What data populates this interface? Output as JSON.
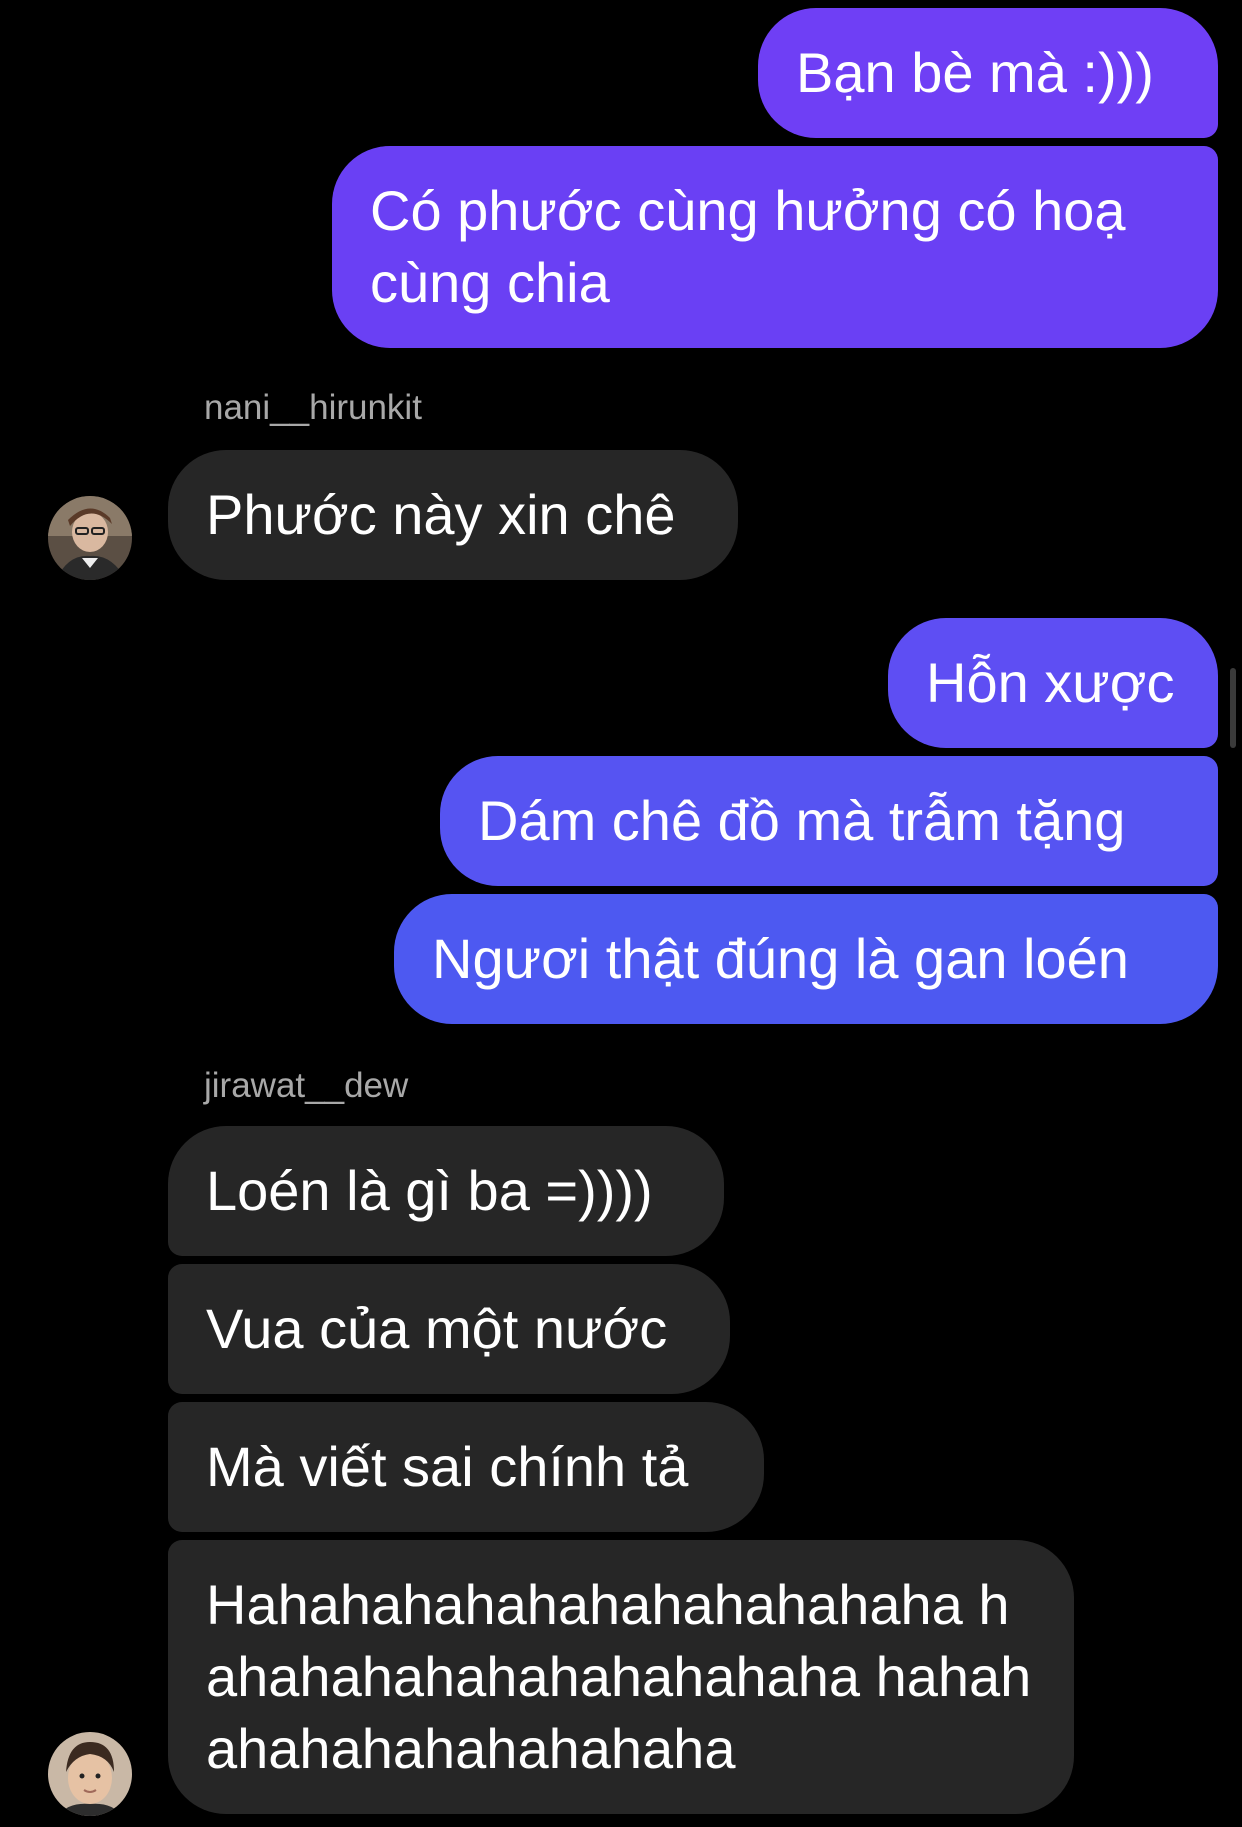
{
  "colors": {
    "background": "#000000",
    "outgoing_bubble_top": "#6f3ff5",
    "outgoing_bubble_mid": "#5a4ff2",
    "outgoing_bubble_bottom": "#4a5bf0",
    "incoming_bubble": "#262626",
    "text": "#ffffff",
    "sender_name": "#a8a8a8"
  },
  "messages": {
    "out_1": "Bạn bè mà :)))",
    "out_2": "Có phước cùng hưởng có hoạ cùng chia",
    "in_group_1": {
      "sender": "nani__hirunkit",
      "avatar_icon": "user-avatar-nani",
      "msg_1": "Phước này xin chê"
    },
    "out_3": "Hỗn xược",
    "out_4": "Dám chê đồ mà trẫm tặng",
    "out_5": "Ngươi thật đúng là gan loén",
    "in_group_2": {
      "sender": "jirawat__dew",
      "avatar_icon": "user-avatar-jirawat",
      "msg_1": "Loén là gì ba =))))",
      "msg_2": "Vua của một nước",
      "msg_3": "Mà viết sai chính tả",
      "msg_4": "Hahahahahahahahahahahaha hahahahahahahahahahaha hahahahahahahahahahaha"
    }
  }
}
